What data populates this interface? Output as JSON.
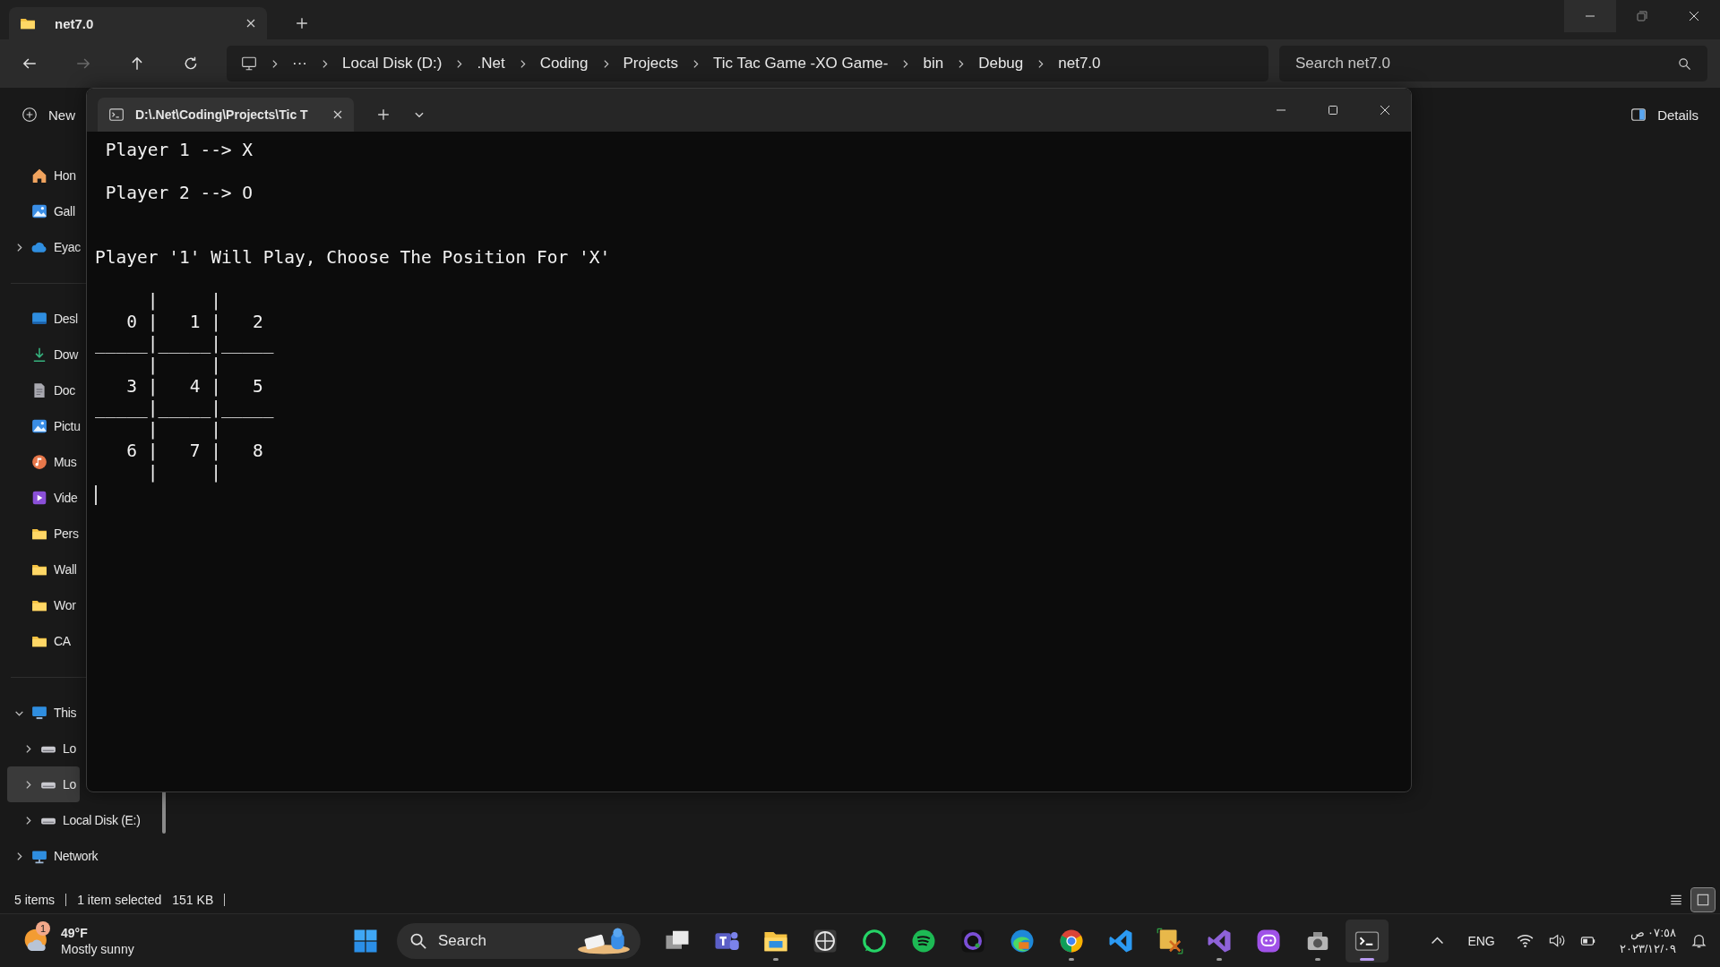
{
  "explorer": {
    "tab": {
      "title": "net7.0"
    },
    "window_controls": [
      {
        "kind": "minimize",
        "hovered": true
      },
      {
        "kind": "restore",
        "hovered": false
      },
      {
        "kind": "close",
        "hovered": false
      }
    ],
    "nav": [
      {
        "kind": "back",
        "disabled": false
      },
      {
        "kind": "forward",
        "disabled": true
      },
      {
        "kind": "up",
        "disabled": false
      },
      {
        "kind": "refresh",
        "disabled": false
      }
    ],
    "address": {
      "overflow": "···",
      "crumbs": [
        "Local Disk (D:)",
        ".Net",
        "Coding",
        "Projects",
        "Tic Tac Game -XO Game-",
        "bin",
        "Debug",
        "net7.0"
      ]
    },
    "search": {
      "placeholder": "Search net7.0"
    },
    "commands": {
      "new": "New",
      "details": "Details"
    },
    "sidebar": {
      "quick": [
        {
          "kind": "home",
          "label": "Hon",
          "selected": false
        },
        {
          "kind": "gallery",
          "label": "Gall",
          "selected": false
        },
        {
          "kind": "cloud",
          "label": "Eyac",
          "selected": false,
          "expanded": false
        }
      ],
      "pinned": [
        {
          "kind": "desktop",
          "label": "Desl",
          "selected": false
        },
        {
          "kind": "download",
          "label": "Dow",
          "selected": false
        },
        {
          "kind": "document",
          "label": "Doc",
          "selected": false
        },
        {
          "kind": "pictures",
          "label": "Pictu",
          "selected": false
        },
        {
          "kind": "music",
          "label": "Mus",
          "selected": false
        },
        {
          "kind": "videos",
          "label": "Vide",
          "selected": false
        },
        {
          "kind": "folder",
          "label": "Pers",
          "selected": false
        },
        {
          "kind": "folder",
          "label": "Wall",
          "selected": false
        },
        {
          "kind": "folder",
          "label": "Wor",
          "selected": false
        },
        {
          "kind": "folder",
          "label": "CA",
          "selected": false
        }
      ],
      "tree": [
        {
          "kind": "pc",
          "label": "This",
          "selected": false,
          "expanded": true,
          "children": [
            {
              "kind": "drive",
              "label": "Lo",
              "selected": false,
              "expanded": false
            },
            {
              "kind": "drive",
              "label": "Lo",
              "selected": true,
              "expanded": false
            },
            {
              "kind": "drive",
              "label": "Local Disk (E:)",
              "selected": false,
              "expanded": false
            }
          ]
        },
        {
          "kind": "network",
          "label": "Network",
          "selected": false,
          "expanded": false
        }
      ]
    },
    "status_bar": {
      "items": "5 items",
      "selection": "1 item selected",
      "size": "151 KB"
    },
    "views": [
      {
        "kind": "details",
        "selected": false
      },
      {
        "kind": "tiles",
        "selected": true
      }
    ]
  },
  "terminal": {
    "tab": {
      "title": "D:\\.Net\\Coding\\Projects\\Tic T"
    },
    "players": [
      "Player 1 --> X",
      "Player 2 --> O"
    ],
    "prompt": "Player '1' Will Play, Choose The Position For 'X'",
    "board": [
      "     |     |",
      "   0 |   1 |   2",
      "_____|_____|_____",
      "     |     |",
      "   3 |   4 |   5",
      "_____|_____|_____",
      "     |     |",
      "   6 |   7 |   8",
      "     |     |"
    ]
  },
  "taskbar": {
    "weather": {
      "badge": "1",
      "temperature": "49°F",
      "condition": "Mostly sunny"
    },
    "search": {
      "placeholder": "Search"
    },
    "apps": [
      {
        "kind": "taskview",
        "running": false,
        "selected": false
      },
      {
        "kind": "team",
        "running": false,
        "selected": false
      },
      {
        "kind": "folder",
        "running": true,
        "selected": false
      },
      {
        "kind": "globe",
        "running": false,
        "selected": false
      },
      {
        "kind": "phone-chat",
        "running": false,
        "selected": false
      },
      {
        "kind": "waves",
        "running": false,
        "selected": false
      },
      {
        "kind": "ring",
        "running": false,
        "selected": false
      },
      {
        "kind": "swirl",
        "running": false,
        "selected": false
      },
      {
        "kind": "round-browser",
        "running": true,
        "selected": false
      },
      {
        "kind": "code",
        "running": false,
        "selected": false
      },
      {
        "kind": "tools",
        "running": false,
        "selected": false
      },
      {
        "kind": "ide",
        "running": true,
        "selected": false
      },
      {
        "kind": "chat",
        "running": false,
        "selected": false
      },
      {
        "kind": "camera",
        "running": true,
        "selected": false
      },
      {
        "kind": "terminal",
        "running": true,
        "selected": true
      }
    ],
    "tray": {
      "language": "ENG",
      "time": "٠٧:٥٨ ص",
      "date": "٢٠٢٣/١٢/٠٩"
    }
  }
}
